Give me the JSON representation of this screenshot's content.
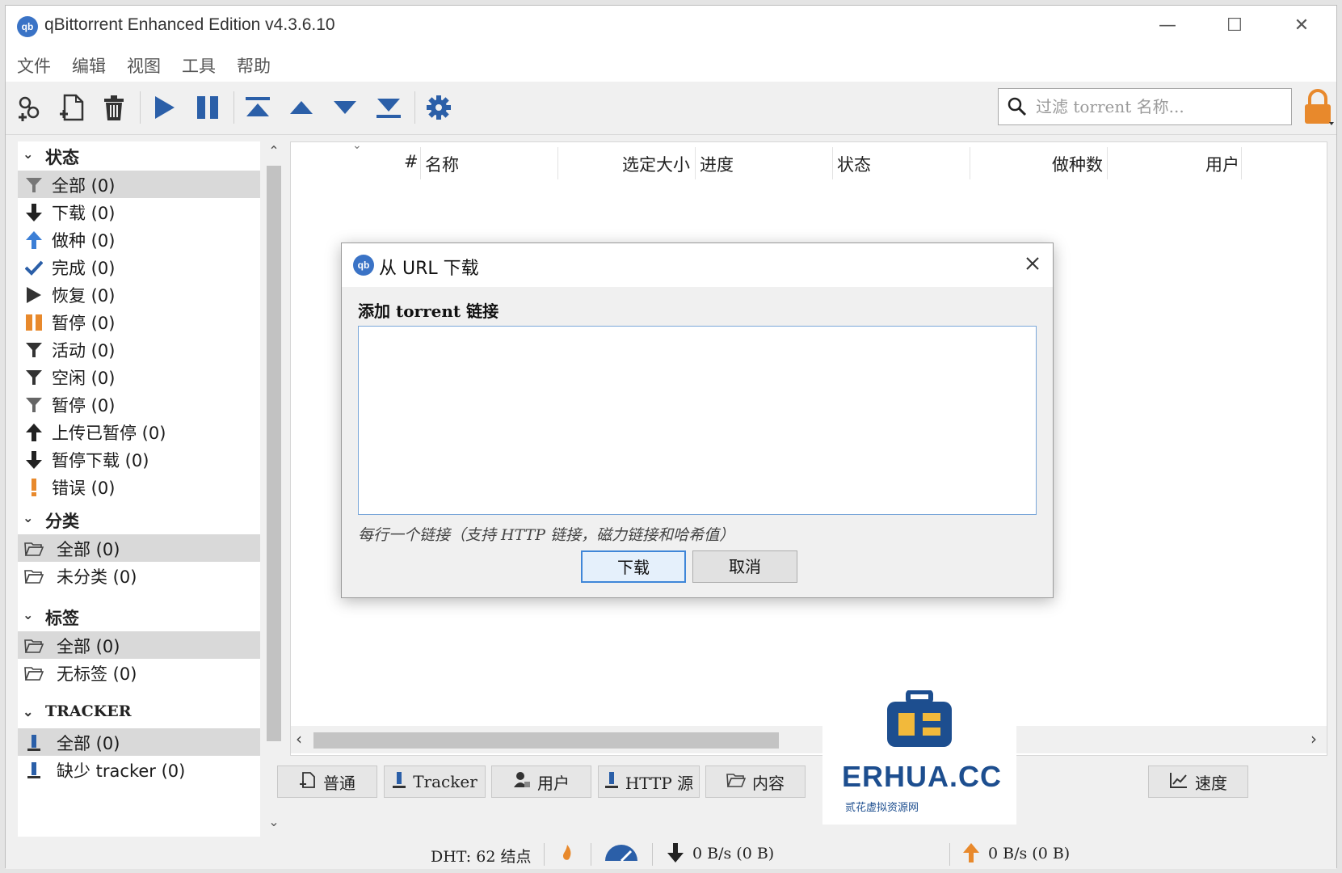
{
  "window": {
    "title": "qBittorrent Enhanced Edition v4.3.6.10",
    "logo_text": "qb",
    "controls": {
      "minimize": "—",
      "maximize": "☐",
      "close": "✕"
    }
  },
  "menu": [
    "文件",
    "编辑",
    "视图",
    "工具",
    "帮助"
  ],
  "toolbar": {
    "icons": [
      "add-link-icon",
      "add-file-icon",
      "delete-icon",
      "resume-icon",
      "pause-icon",
      "move-top-icon",
      "move-up-icon",
      "move-down-icon",
      "move-bottom-icon",
      "settings-icon"
    ],
    "search_placeholder": "过滤 torrent 名称...",
    "accent": "#2b5fa8"
  },
  "sidebar": {
    "status": {
      "header": "状态",
      "items": [
        {
          "label": "全部 (0)",
          "icon": "filter-icon"
        },
        {
          "label": "下载 (0)",
          "icon": "arrow-down-icon"
        },
        {
          "label": "做种 (0)",
          "icon": "arrow-up-icon"
        },
        {
          "label": "完成 (0)",
          "icon": "check-icon"
        },
        {
          "label": "恢复 (0)",
          "icon": "play-icon"
        },
        {
          "label": "暂停 (0)",
          "icon": "pause-icon"
        },
        {
          "label": "活动 (0)",
          "icon": "filter-icon"
        },
        {
          "label": "空闲 (0)",
          "icon": "filter-icon"
        },
        {
          "label": "暂停 (0)",
          "icon": "filter-icon"
        },
        {
          "label": "上传已暂停 (0)",
          "icon": "arrow-up-icon"
        },
        {
          "label": "暂停下载 (0)",
          "icon": "arrow-down-icon"
        },
        {
          "label": "错误 (0)",
          "icon": "error-icon"
        }
      ]
    },
    "category": {
      "header": "分类",
      "items": [
        {
          "label": "全部 (0)"
        },
        {
          "label": "未分类 (0)"
        }
      ]
    },
    "tags": {
      "header": "标签",
      "items": [
        {
          "label": "全部 (0)"
        },
        {
          "label": "无标签 (0)"
        }
      ]
    },
    "tracker": {
      "header": "TRACKER",
      "items": [
        {
          "label": "全部 (0)"
        },
        {
          "label": "缺少 tracker (0)"
        }
      ]
    }
  },
  "table": {
    "columns": [
      "#",
      "名称",
      "选定大小",
      "进度",
      "状态",
      "做种数",
      "用户"
    ]
  },
  "bottom_tabs": [
    "普通",
    "Tracker",
    "用户",
    "HTTP 源",
    "内容"
  ],
  "speed_button": "速度",
  "statusbar": {
    "dht": "DHT: 62 结点",
    "download": "0 B/s (0 B)",
    "upload": "0 B/s (0 B)"
  },
  "dialog": {
    "title": "从 URL 下载",
    "label": "添加 torrent 链接",
    "hint": "每行一个链接（支持 HTTP 链接，磁力链接和哈希值）",
    "textarea_value": "",
    "download_button": "下载",
    "cancel_button": "取消"
  },
  "watermark": {
    "text": "ERHUA.CC",
    "subtext": "贰花虚拟资源网"
  }
}
